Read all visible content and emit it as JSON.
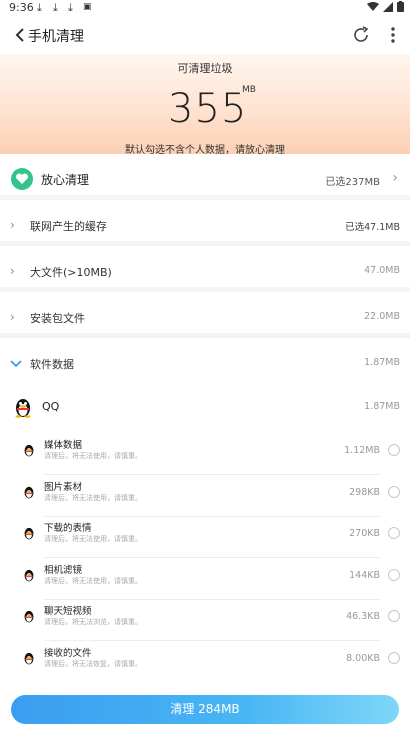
{
  "status_bar": {
    "time": "9:36"
  },
  "app_bar": {
    "title": "手机清理"
  },
  "hero": {
    "label": "可清理垃圾",
    "value": "355",
    "unit": "MB",
    "note": "默认勾选不含个人数据，请放心清理"
  },
  "safe_clean": {
    "label": "放心清理",
    "value": "已选237MB"
  },
  "groups": [
    {
      "label": "联网产生的缓存",
      "value": "已选47.1MB"
    },
    {
      "label": "大文件(>10MB)",
      "value": "47.0MB"
    },
    {
      "label": "安装包文件",
      "value": "22.0MB"
    },
    {
      "label": "软件数据",
      "value": "1.87MB"
    }
  ],
  "app": {
    "name": "QQ",
    "value": "1.87MB"
  },
  "items": [
    {
      "title": "媒体数据",
      "desc": "清理后，将无法使用，请慎重。",
      "value": "1.12MB"
    },
    {
      "title": "图片素材",
      "desc": "清理后，将无法使用，请慎重。",
      "value": "298KB"
    },
    {
      "title": "下载的表情",
      "desc": "清理后，将无法使用，请慎重。",
      "value": "270KB"
    },
    {
      "title": "相机滤镜",
      "desc": "清理后，将无法使用，请慎重。",
      "value": "144KB"
    },
    {
      "title": "聊天短视频",
      "desc": "清理后，将无法浏览，请慎重。",
      "value": "46.3KB"
    },
    {
      "title": "接收的文件",
      "desc": "清理后，将无法恢复，请慎重。",
      "value": "8.00KB"
    }
  ],
  "clean_button": {
    "label": "清理 284MB"
  },
  "colors": {
    "accent": "#3a9ef0",
    "safe_green": "#34c48b",
    "hero_bg": "#fbd0b4"
  }
}
